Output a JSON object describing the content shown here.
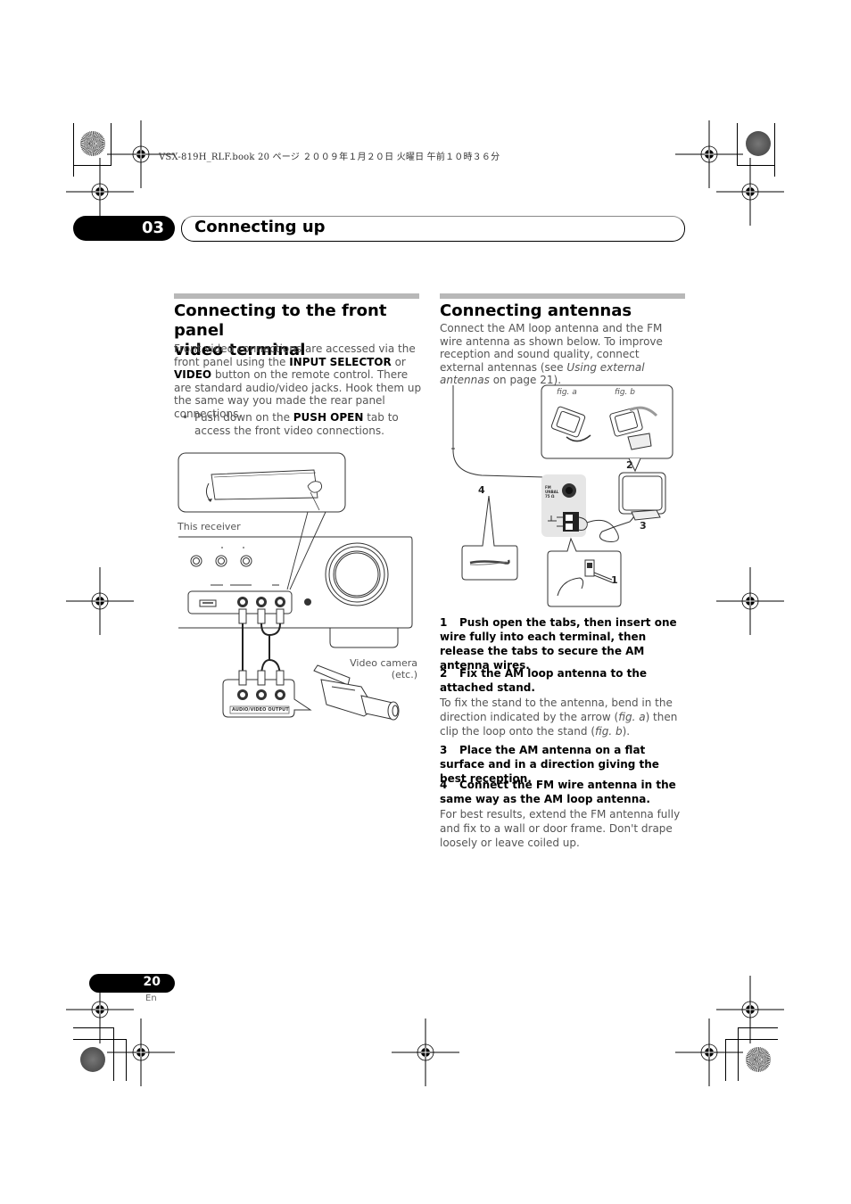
{
  "print_header": {
    "meta_text": "VSX-819H_RLF.book  20 ページ  ２００９年１月２０日  火曜日  午前１０時３６分"
  },
  "chapter": {
    "number": "03",
    "title": "Connecting up"
  },
  "left_section": {
    "title_line1": "Connecting to the front panel",
    "title_line2": "video terminal",
    "para_part1": "Front video connections are accessed via the front panel using the ",
    "para_bold1": "INPUT SELECTOR",
    "para_part2": " or ",
    "para_bold2": "VIDEO",
    "para_part3": " button on the remote control. There are standard audio/video jacks. Hook them up the same way you made the rear panel connections.",
    "bullet_part1": "Push down on the ",
    "bullet_bold": "PUSH OPEN",
    "bullet_part2": " tab to access the front video connections.",
    "figure": {
      "receiver_label": "This receiver",
      "camera_label_line1": "Video camera",
      "camera_label_line2": "(etc.)",
      "output_panel_label": "AUDIO/VIDEO OUTPUT"
    }
  },
  "right_section": {
    "title": "Connecting antennas",
    "intro_part1": "Connect the AM loop antenna and the FM wire antenna as shown below. To improve reception and sound quality, connect external antennas (see ",
    "intro_italic": "Using external antennas",
    "intro_part2": " on page 21).",
    "figure": {
      "fig_a": "fig. a",
      "fig_b": "fig. b",
      "callouts": [
        "1",
        "2",
        "3",
        "4"
      ],
      "terminal_label": "FM UNBAL 75 Ω"
    },
    "steps": [
      {
        "number": "1",
        "heading": "Push open the tabs, then insert one wire fully into each terminal, then release the tabs to secure the AM antenna wires."
      },
      {
        "number": "2",
        "heading": "Fix the AM loop antenna to the attached stand.",
        "body_part1": "To fix the stand to the antenna, bend in the direction indicated by the arrow (",
        "body_italic1": "fig. a",
        "body_part2": ") then clip the loop onto the stand (",
        "body_italic2": "fig. b",
        "body_part3": ")."
      },
      {
        "number": "3",
        "heading": "Place the AM antenna on a flat surface and in a direction giving the best reception."
      },
      {
        "number": "4",
        "heading": "Connect the FM wire antenna in the same way as the AM loop antenna.",
        "body": "For best results, extend the FM antenna fully and fix to a wall or door frame. Don't drape loosely or leave coiled up."
      }
    ]
  },
  "footer": {
    "page_number": "20",
    "language": "En"
  }
}
